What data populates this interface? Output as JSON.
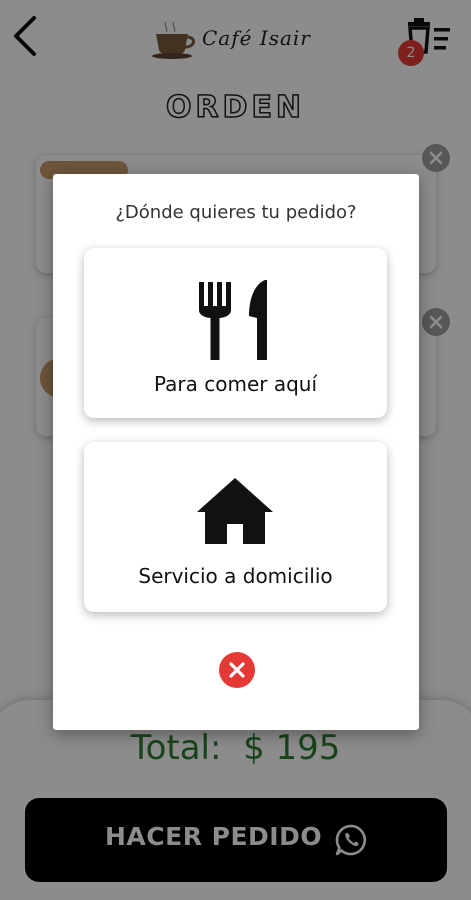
{
  "header": {
    "back_icon": "back-arrow-icon",
    "logo_text": "Café Isair",
    "cart_icon": "cart-list-icon",
    "cart_count": "2"
  },
  "order": {
    "title": "ORDEN",
    "remove_icon": "close-icon"
  },
  "summary": {
    "total_text": "Total:  $ 195",
    "total_color": "#2e7d32",
    "order_button_label": "HACER PEDIDO",
    "order_button_icon": "whatsapp-icon"
  },
  "modal": {
    "question": "¿Dónde quieres tu pedido?",
    "options": [
      {
        "label": "Para comer aquí",
        "icon": "fork-knife-icon"
      },
      {
        "label": "Servicio a domicilio",
        "icon": "house-icon"
      }
    ],
    "close_icon": "close-icon",
    "close_color": "#e53935"
  }
}
